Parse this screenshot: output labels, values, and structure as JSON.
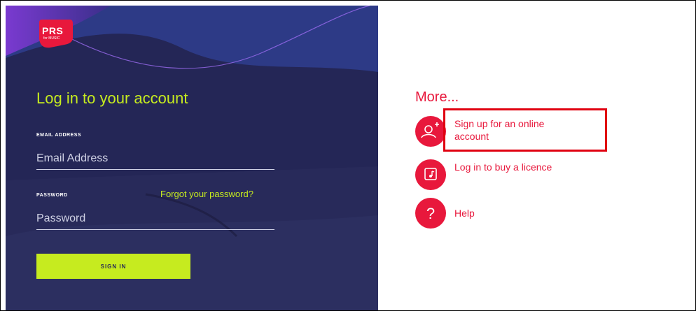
{
  "logo": {
    "brand": "PRS",
    "tagline": "for MUSIC"
  },
  "login": {
    "title": "Log in to your account",
    "email_label": "EMAIL ADDRESS",
    "email_placeholder": "Email Address",
    "password_label": "PASSWORD",
    "password_placeholder": "Password",
    "forgot_label": "Forgot your password?",
    "signin_label": "SIGN IN"
  },
  "more": {
    "title": "More...",
    "items": [
      {
        "label": "Sign up for an online account",
        "icon": "add-user-icon"
      },
      {
        "label": "Log in to buy a licence",
        "icon": "music-licence-icon"
      },
      {
        "label": "Help",
        "icon": "question-icon"
      }
    ]
  },
  "colors": {
    "accent_green": "#c6eb1f",
    "accent_red": "#e8183c",
    "panel_navy": "#232553",
    "highlight": "#e00010"
  }
}
